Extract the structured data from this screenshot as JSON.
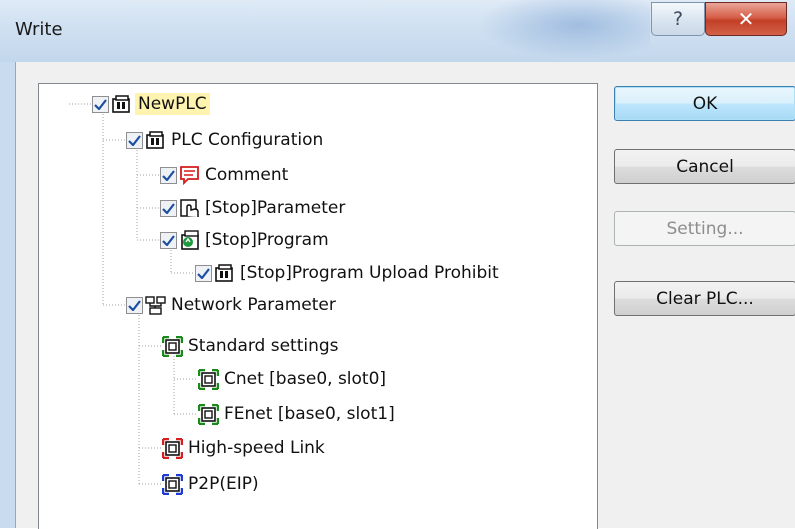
{
  "window": {
    "title": "Write"
  },
  "titlebar": {
    "help_glyph": "?",
    "close_glyph": "✕"
  },
  "buttons": {
    "ok": "OK",
    "cancel": "Cancel",
    "setting": "Setting...",
    "clear_plc": "Clear PLC..."
  },
  "tree": [
    {
      "label": "NewPLC",
      "checked": true,
      "icon": "plc-icon",
      "selected": true
    },
    {
      "label": "PLC Configuration",
      "checked": true,
      "icon": "plc-icon"
    },
    {
      "label": "Comment",
      "checked": true,
      "icon": "comment-icon"
    },
    {
      "label": "[Stop]Parameter",
      "checked": true,
      "icon": "parameter-icon"
    },
    {
      "label": "[Stop]Program",
      "checked": true,
      "icon": "program-icon"
    },
    {
      "label": "[Stop]Program Upload Prohibit",
      "checked": true,
      "icon": "plc-icon"
    },
    {
      "label": "Network Parameter",
      "checked": true,
      "icon": "network-icon"
    },
    {
      "label": "Standard settings",
      "icon": "network-module-icon",
      "color": "#1a8a1a"
    },
    {
      "label": "Cnet [base0, slot0]",
      "icon": "network-module-icon",
      "color": "#1a8a1a"
    },
    {
      "label": "FEnet [base0, slot1]",
      "icon": "network-module-icon",
      "color": "#1a8a1a"
    },
    {
      "label": "High-speed Link",
      "icon": "network-module-icon",
      "color": "#d42020"
    },
    {
      "label": "P2P(EIP)",
      "icon": "network-module-icon",
      "color": "#1c3ad6"
    }
  ]
}
